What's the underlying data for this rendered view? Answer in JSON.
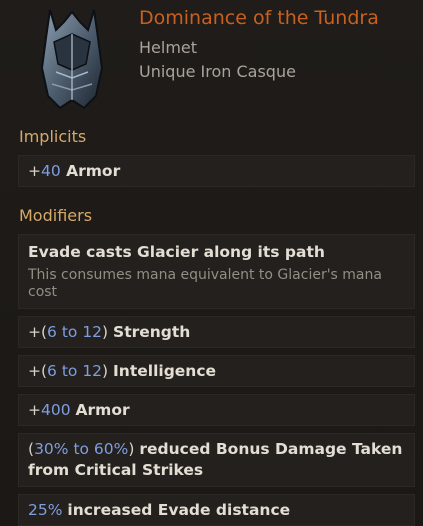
{
  "item": {
    "name": "Dominance of the Tundra",
    "type": "Helmet",
    "base": "Unique Iron Casque",
    "icon": "helmet-icon"
  },
  "implicits": {
    "title": "Implicits",
    "items": [
      {
        "prefix": "+",
        "value": "40",
        "suffix": " Armor"
      }
    ]
  },
  "modifiers": {
    "title": "Modifiers",
    "items": [
      {
        "text": "Evade casts Glacier along its path",
        "description": "This consumes mana equivalent to Glacier's mana cost"
      },
      {
        "prefix": "+(",
        "value": "6 to 12",
        "mid": ") ",
        "suffix": "Strength"
      },
      {
        "prefix": "+(",
        "value": "6 to 12",
        "mid": ") ",
        "suffix": "Intelligence"
      },
      {
        "prefix": "+",
        "value": "400",
        "mid": " ",
        "suffix": "Armor"
      },
      {
        "prefix": "(",
        "value": "30% to 60%",
        "mid": ") ",
        "suffix": "reduced Bonus Damage Taken from Critical Strikes"
      },
      {
        "prefix": "",
        "value": "25%",
        "mid": " ",
        "suffix": "increased Evade distance"
      }
    ]
  },
  "colors": {
    "name": "#c8611f",
    "section": "#d6a96a",
    "value": "#7f9ee0"
  }
}
